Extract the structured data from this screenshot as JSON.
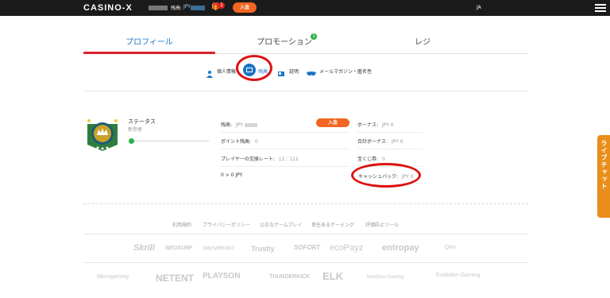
{
  "header": {
    "logo": "CASINO-X",
    "balance_label": "残高:",
    "balance_currency": "JPY",
    "gift_badge": "1",
    "deposit_label": "入金",
    "lang": "JA"
  },
  "tabs": [
    {
      "label": "プロフィール",
      "active": true
    },
    {
      "label": "プロモーション",
      "badge": "1"
    },
    {
      "label": "レジ"
    }
  ],
  "subnav": [
    {
      "label": "個人情報",
      "icon": "person-icon"
    },
    {
      "label": "残高",
      "icon": "wallet-icon",
      "active": true
    },
    {
      "label": "証明",
      "icon": "id-card-icon"
    },
    {
      "label": "メールマガジン・匿名性",
      "icon": "mask-icon"
    }
  ],
  "status": {
    "label": "ステータス",
    "level": "新参者"
  },
  "balance_grid": {
    "balance_label": "残高:",
    "balance_value": "JPY",
    "deposit_button": "入金",
    "points_label": "ポイント残高:",
    "points_value": "0",
    "rate_label": "プレイヤーの交換レート:",
    "rate_value": "12 : 112",
    "conversion": "0 > 0 JPY",
    "bonus_label": "ボーナス:",
    "bonus_value": "JPY 0",
    "total_bonus_label": "合計ボーナス:",
    "total_bonus_value": "JPY 0",
    "lottery_label": "宝くじ券:",
    "lottery_value": "0",
    "cashback_label": "キャッシュバック:",
    "cashback_value": "JPY 0"
  },
  "footer_links": [
    "利用規約",
    "プライバシーポリシー",
    "公正なゲームプレイ",
    "責任あるゲーミング",
    "評価防止ツール"
  ],
  "payment_logos": [
    "Skrill",
    "NEOSURF",
    "paysafecard",
    "Trustly",
    "SOFORT",
    "ecoPayz",
    "entropay",
    "Qiwi"
  ],
  "provider_logos": [
    "Microgaming",
    "NETENT",
    "PLAYSON",
    "THUNDERKICK",
    "ELK",
    "NextGen Gaming",
    "Evolution Gaming"
  ],
  "live_chat": "ライブチャット",
  "colors": {
    "accent": "#f26522",
    "link": "#1a74c4",
    "highlight": "#d11111",
    "topbar": "#1b1b1b"
  }
}
